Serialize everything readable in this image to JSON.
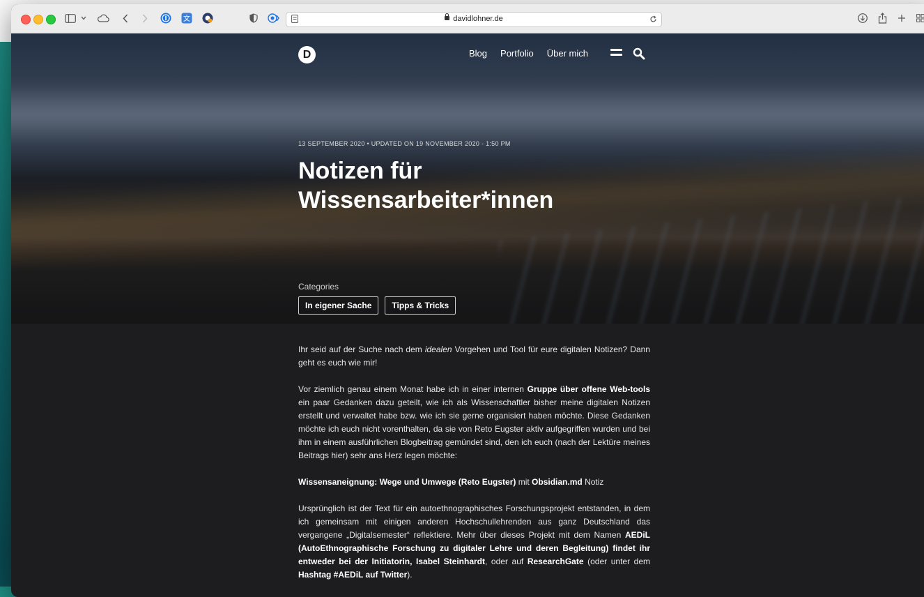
{
  "browser": {
    "url": "davidlohner.de"
  },
  "site": {
    "logo": "D",
    "nav": [
      "Blog",
      "Portfolio",
      "Über mich"
    ]
  },
  "post": {
    "meta": "13 SEPTEMBER 2020 • UPDATED ON 19 NOVEMBER 2020 - 1:50 PM",
    "title": "Notizen für Wissensarbeiter*innen",
    "categories_label": "Categories",
    "categories": [
      "In eigener Sache",
      "Tipps & Tricks"
    ]
  },
  "article": {
    "p1": {
      "a": "Ihr seid auf der Suche nach dem ",
      "em": "idealen",
      "b": " Vorgehen und Tool für eure digitalen Notizen? Dann geht es euch wie mir!"
    },
    "p2": {
      "a": "Vor ziemlich genau einem Monat habe ich in einer internen ",
      "strong": "Gruppe über offene Web-tools",
      "b": " ein paar Gedanken dazu geteilt, wie ich als Wissenschaftler bisher meine digitalen Notizen erstellt und verwaltet habe bzw. wie ich sie gerne organisiert haben möchte. Diese Gedanken möchte ich euch nicht vorenthalten, da sie von Reto Eugster aktiv aufgegriffen wurden und bei ihm in einem ausführlichen Blogbeitrag gemündet sind, den ich euch (nach der Lektüre meines Beitrags hier) sehr ans Herz legen möchte:"
    },
    "p3": {
      "strong1": "Wissensaneignung: Wege und Umwege (Reto Eugster)",
      "mid": " mit ",
      "strong2": "Obsidian.md",
      "end": " Notiz"
    },
    "p4": {
      "a": "Ursprünglich ist der Text für ein autoethnographisches Forschungsprojekt entstanden, in dem ich gemeinsam mit einigen anderen Hochschullehrenden aus ganz Deutschland das vergangene „Digitalsemester“ reflektiere. Mehr über dieses Projekt mit dem Namen ",
      "strong1": "AEDiL (AutoEthnographische Forschung zu digitaler Lehre und deren Begleitung) findet ihr entweder bei der Initiatorin, Isabel Steinhardt",
      "mid": ", oder auf ",
      "strong2": "ResearchGate",
      "b": " (oder unter dem ",
      "strong3": "Hashtag #AEDiL auf Twitter",
      "end": ")."
    }
  },
  "icons": [
    "sidebar-icon",
    "chevron-down-icon",
    "icloud-icon",
    "back-icon",
    "forward-icon",
    "onepassword-icon",
    "translate-icon",
    "extension-icon",
    "privacy-shield-icon",
    "tracker-icon",
    "reader-icon",
    "reload-icon",
    "download-icon",
    "share-icon",
    "new-tab-icon",
    "tab-overview-icon",
    "menu-icon",
    "search-icon"
  ]
}
